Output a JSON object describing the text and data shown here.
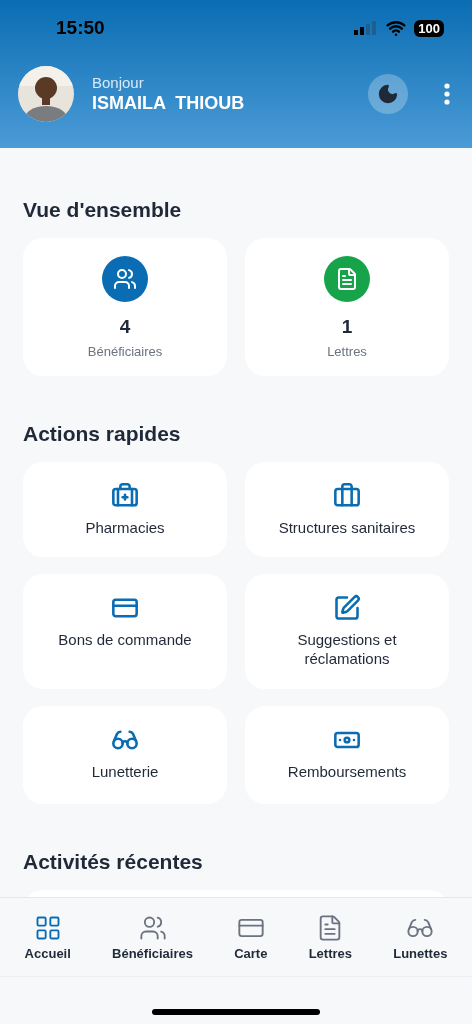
{
  "status_bar": {
    "time": "15:50",
    "battery": "100"
  },
  "header": {
    "greeting": "Bonjour",
    "name": "ISMAILA  THIOUB"
  },
  "overview": {
    "title": "Vue d'ensemble",
    "stats": [
      {
        "kind": "users",
        "value": "4",
        "label": "Bénéficiaires",
        "color": "#0a6db3"
      },
      {
        "kind": "letter",
        "value": "1",
        "label": "Lettres",
        "color": "#17a34a"
      }
    ]
  },
  "quick_actions": {
    "title": "Actions rapides",
    "items": [
      {
        "kind": "pharmacy",
        "label": "Pharmacies"
      },
      {
        "kind": "health",
        "label": "Structures sanitaires"
      },
      {
        "kind": "order",
        "label": "Bons de commande"
      },
      {
        "kind": "suggestion",
        "label": "Suggestions et réclamations"
      },
      {
        "kind": "glasses",
        "label": "Lunetterie"
      },
      {
        "kind": "refund",
        "label": "Remboursements"
      }
    ]
  },
  "recent": {
    "title": "Activités récentes"
  },
  "nav": [
    {
      "kind": "home",
      "label": "Accueil",
      "selected": true
    },
    {
      "kind": "users",
      "label": "Bénéficiaires",
      "selected": false
    },
    {
      "kind": "card",
      "label": "Carte",
      "selected": false
    },
    {
      "kind": "letter",
      "label": "Lettres",
      "selected": false
    },
    {
      "kind": "glasses",
      "label": "Lunettes",
      "selected": false
    }
  ]
}
